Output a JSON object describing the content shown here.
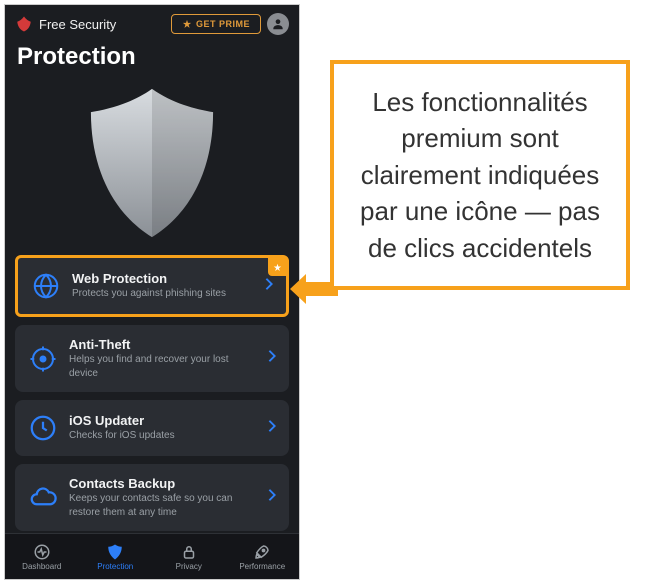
{
  "header": {
    "app_name": "Free Security",
    "prime_label": "GET PRIME"
  },
  "page_title": "Protection",
  "items": [
    {
      "title": "Web Protection",
      "subtitle": "Protects you against phishing sites",
      "premium": true,
      "highlighted": true,
      "icon": "globe"
    },
    {
      "title": "Anti-Theft",
      "subtitle": "Helps you find and recover your lost device",
      "icon": "target"
    },
    {
      "title": "iOS Updater",
      "subtitle": "Checks for iOS updates",
      "icon": "refresh"
    },
    {
      "title": "Contacts Backup",
      "subtitle": "Keeps your contacts safe so you can restore them at any time",
      "icon": "cloud"
    }
  ],
  "tabs": [
    {
      "label": "Dashboard",
      "icon": "pulse"
    },
    {
      "label": "Protection",
      "icon": "shield",
      "active": true
    },
    {
      "label": "Privacy",
      "icon": "lock"
    },
    {
      "label": "Performance",
      "icon": "rocket"
    }
  ],
  "callout_text": "Les fonctionnalités premium sont clairement indiquées par une icône — pas de clics accidentels"
}
